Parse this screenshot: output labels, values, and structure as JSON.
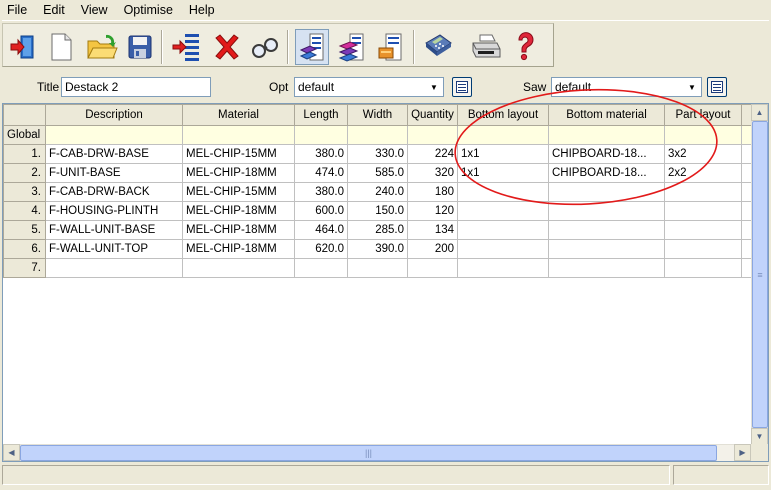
{
  "menu": {
    "items": [
      "File",
      "Edit",
      "View",
      "Optimise",
      "Help"
    ]
  },
  "toolbar": {
    "buttons": [
      {
        "name": "exit-icon"
      },
      {
        "name": "new-document-icon"
      },
      {
        "name": "open-folder-icon"
      },
      {
        "name": "save-disk-icon"
      },
      {
        "name": "import-list-icon"
      },
      {
        "name": "delete-x-icon"
      },
      {
        "name": "search-glasses-icon"
      },
      {
        "name": "parts-list-icon",
        "pressed": true
      },
      {
        "name": "boards-list-icon"
      },
      {
        "name": "edging-list-icon"
      },
      {
        "name": "calculator-icon"
      },
      {
        "name": "printer-icon"
      },
      {
        "name": "help-question-icon"
      }
    ]
  },
  "form": {
    "title_label": "Title",
    "title_value": "Destack 2",
    "opt_label": "Opt",
    "opt_value": "default",
    "saw_label": "Saw",
    "saw_value": "default"
  },
  "grid": {
    "columns": [
      "",
      "Description",
      "Material",
      "Length",
      "Width",
      "Quantity",
      "Bottom layout",
      "Bottom material",
      "Part layout"
    ],
    "global_label": "Global",
    "rows": [
      {
        "n": "1.",
        "description": "F-CAB-DRW-BASE",
        "material": "MEL-CHIP-15MM",
        "length": "380.0",
        "width": "330.0",
        "quantity": "224",
        "bottom_layout": "1x1",
        "bottom_material": "CHIPBOARD-18...",
        "part_layout": "3x2"
      },
      {
        "n": "2.",
        "description": "F-UNIT-BASE",
        "material": "MEL-CHIP-18MM",
        "length": "474.0",
        "width": "585.0",
        "quantity": "320",
        "bottom_layout": "1x1",
        "bottom_material": "CHIPBOARD-18...",
        "part_layout": "2x2"
      },
      {
        "n": "3.",
        "description": "F-CAB-DRW-BACK",
        "material": "MEL-CHIP-15MM",
        "length": "380.0",
        "width": "240.0",
        "quantity": "180",
        "bottom_layout": "",
        "bottom_material": "",
        "part_layout": ""
      },
      {
        "n": "4.",
        "description": "F-HOUSING-PLINTH",
        "material": "MEL-CHIP-18MM",
        "length": "600.0",
        "width": "150.0",
        "quantity": "120",
        "bottom_layout": "",
        "bottom_material": "",
        "part_layout": ""
      },
      {
        "n": "5.",
        "description": "F-WALL-UNIT-BASE",
        "material": "MEL-CHIP-18MM",
        "length": "464.0",
        "width": "285.0",
        "quantity": "134",
        "bottom_layout": "",
        "bottom_material": "",
        "part_layout": ""
      },
      {
        "n": "6.",
        "description": "F-WALL-UNIT-TOP",
        "material": "MEL-CHIP-18MM",
        "length": "620.0",
        "width": "390.0",
        "quantity": "200",
        "bottom_layout": "",
        "bottom_material": "",
        "part_layout": ""
      },
      {
        "n": "7.",
        "description": "",
        "material": "",
        "length": "",
        "width": "",
        "quantity": "",
        "bottom_layout": "",
        "bottom_material": "",
        "part_layout": ""
      }
    ]
  },
  "colors": {
    "annotation": "#e21a1a",
    "global_row": "#ffffe1",
    "header_bg": "#ece9d8"
  }
}
